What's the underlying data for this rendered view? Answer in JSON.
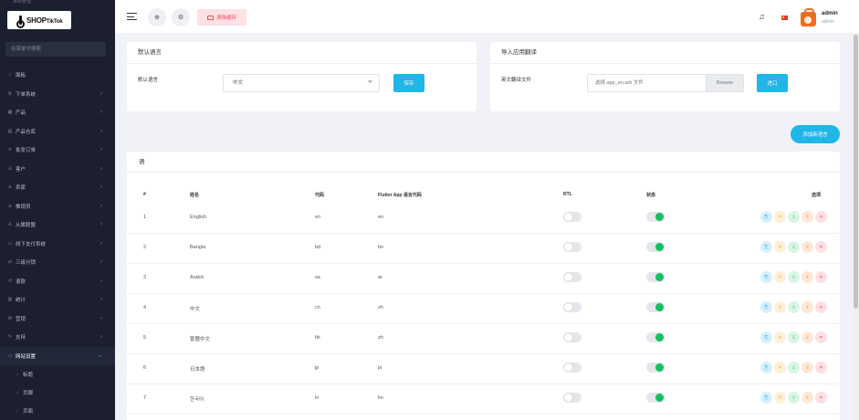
{
  "sidebar": {
    "top_cut_text": "系统管理",
    "logo": {
      "main": "SHOP",
      "sub": "TikTok"
    },
    "search_placeholder": "在菜单中搜索",
    "items": [
      {
        "label": "面板",
        "icon": "dashboard-icon",
        "glyph": "⌂",
        "chev": ""
      },
      {
        "label": "下单系统",
        "icon": "order-system-icon",
        "glyph": "⇅",
        "chev": "›"
      },
      {
        "label": "产品",
        "icon": "product-icon",
        "glyph": "▦",
        "chev": "›"
      },
      {
        "label": "产品仓库",
        "icon": "warehouse-icon",
        "glyph": "▤",
        "chev": "›"
      },
      {
        "label": "批发订单",
        "icon": "wholesale-icon",
        "glyph": "≡",
        "chev": "›"
      },
      {
        "label": "客户",
        "icon": "customer-icon",
        "glyph": "♙",
        "chev": "›"
      },
      {
        "label": "卖家",
        "icon": "seller-icon",
        "glyph": "♙",
        "chev": "›"
      },
      {
        "label": "推销员",
        "icon": "salesman-icon",
        "glyph": "♙",
        "chev": "›"
      },
      {
        "label": "从属联盟",
        "icon": "affiliate-icon",
        "glyph": "♙",
        "chev": "›"
      },
      {
        "label": "线下支付系统",
        "icon": "offline-payment-icon",
        "glyph": "▭",
        "chev": "›"
      },
      {
        "label": "三级分销",
        "icon": "distribution-icon",
        "glyph": "⇄",
        "chev": "›"
      },
      {
        "label": "退款",
        "icon": "refund-icon",
        "glyph": "↺",
        "chev": "›"
      },
      {
        "label": "统计",
        "icon": "statistics-icon",
        "glyph": "▥",
        "chev": "›"
      },
      {
        "label": "营销",
        "icon": "marketing-icon",
        "glyph": "✉",
        "chev": "›"
      },
      {
        "label": "支持",
        "icon": "support-icon",
        "glyph": "✎",
        "chev": "›"
      },
      {
        "label": "网站设置",
        "icon": "website-settings-icon",
        "glyph": "▭",
        "chev": "⌄",
        "active": true
      },
      {
        "label": "标题",
        "icon": "sub-dot-icon",
        "glyph": "○",
        "chev": "",
        "sub": true
      },
      {
        "label": "页脚",
        "icon": "sub-dot-icon",
        "glyph": "○",
        "chev": "",
        "sub": true
      },
      {
        "label": "页面",
        "icon": "sub-dot-icon",
        "glyph": "○",
        "chev": "",
        "sub": true
      }
    ]
  },
  "header": {
    "clear_cache": "清除缓存",
    "user_name": "admin",
    "user_role": "admin"
  },
  "default_lang": {
    "title": "默认语言",
    "field_label": "默认语言",
    "selected": "中文",
    "save": "保存"
  },
  "import": {
    "title": "导入应用翻译",
    "field_label": "英文翻译文件",
    "placeholder": "选择 app_en.arb 文件",
    "browse": "Browse",
    "submit": "进口"
  },
  "add_language": "添加新语言",
  "table": {
    "title": "语",
    "headers": {
      "num": "#",
      "name": "姓名",
      "code": "代码",
      "flutter": "Flutter App 语言代码",
      "rtl": "RTL",
      "active": "状态",
      "options": "选项"
    },
    "rows": [
      {
        "num": "1",
        "name": "English",
        "code": "en",
        "flutter": "en",
        "rtl": false,
        "active": true
      },
      {
        "num": "2",
        "name": "Bangla",
        "code": "bd",
        "flutter": "bn",
        "rtl": false,
        "active": true
      },
      {
        "num": "3",
        "name": "Arabic",
        "code": "sa",
        "flutter": "ar",
        "rtl": false,
        "active": true
      },
      {
        "num": "4",
        "name": "中文",
        "code": "cn",
        "flutter": "zh",
        "rtl": false,
        "active": true
      },
      {
        "num": "5",
        "name": "繁體中文",
        "code": "hk",
        "flutter": "zh",
        "rtl": false,
        "active": true
      },
      {
        "num": "6",
        "name": "日本語",
        "code": "jp",
        "flutter": "ja",
        "rtl": false,
        "active": true
      },
      {
        "num": "7",
        "name": "한국어",
        "code": "kr",
        "flutter": "ko",
        "rtl": false,
        "active": true
      }
    ]
  },
  "row_actions": [
    {
      "name": "translate-icon",
      "glyph": "⎘",
      "cls": "c1"
    },
    {
      "name": "edit-icon",
      "glyph": "✎",
      "cls": "c2"
    },
    {
      "name": "download-icon",
      "glyph": "⇩",
      "cls": "c3"
    },
    {
      "name": "upload-icon",
      "glyph": "⇪",
      "cls": "c4"
    },
    {
      "name": "delete-icon",
      "glyph": "✕",
      "cls": "c5"
    }
  ],
  "colors": {
    "accent": "#1fb6e8",
    "sidebar_bg": "#1b1f2e",
    "danger": "#e74a5b",
    "toggle_on": "#15c05e"
  }
}
